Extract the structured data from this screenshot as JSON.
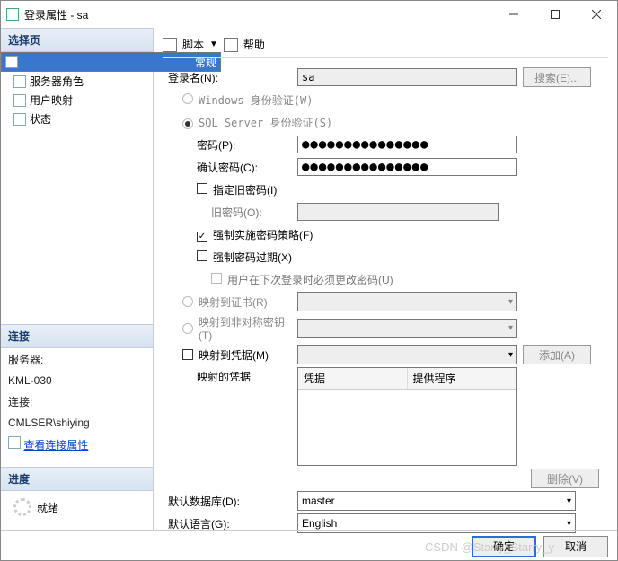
{
  "title": "登录属性 - sa",
  "left": {
    "select_page": "选择页",
    "items": [
      "常规",
      "服务器角色",
      "用户映射",
      "状态"
    ],
    "connect_hdr": "连接",
    "server_lbl": "服务器:",
    "server_val": "KML-030",
    "conn_lbl": "连接:",
    "conn_val": "CMLSER\\shiying",
    "view_conn": "查看连接属性",
    "progress_hdr": "进度",
    "ready": "就绪"
  },
  "toolbar": {
    "script": "脚本",
    "help": "帮助"
  },
  "form": {
    "login_lbl": "登录名(N):",
    "login_val": "sa",
    "search": "搜索(E)...",
    "auth_win": "Windows 身份验证(W)",
    "auth_sql": "SQL Server 身份验证(S)",
    "pwd_lbl": "密码(P):",
    "pwd_val": "●●●●●●●●●●●●●●●",
    "cpwd_lbl": "确认密码(C):",
    "cpwd_val": "●●●●●●●●●●●●●●●",
    "spec_old": "指定旧密码(I)",
    "old_lbl": "旧密码(O):",
    "enforce_policy": "强制实施密码策略(F)",
    "enforce_expire": "强制密码过期(X)",
    "must_change": "用户在下次登录时必须更改密码(U)",
    "map_cert": "映射到证书(R)",
    "map_akey": "映射到非对称密钥(T)",
    "map_cred": "映射到凭据(M)",
    "add": "添加(A)",
    "mapped_creds": "映射的凭据",
    "col_cred": "凭据",
    "col_prov": "提供程序",
    "remove": "删除(V)",
    "def_db": "默认数据库(D):",
    "def_db_val": "master",
    "def_lang": "默认语言(G):",
    "def_lang_val": "English"
  },
  "footer": {
    "ok": "确定",
    "cancel": "取消"
  },
  "watermark": "CSDN @Starry_Starry_y"
}
